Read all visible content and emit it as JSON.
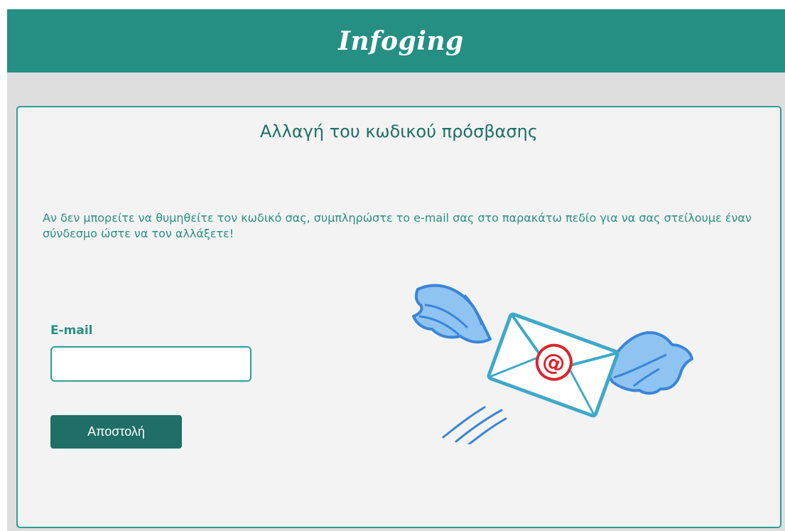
{
  "header": {
    "brand": "Infoging"
  },
  "card": {
    "title": "Αλλαγή του κωδικού πρόσβασης",
    "intro": "Αν δεν μπορείτε να θυμηθείτε τον κωδικό σας, συμπληρώστε το e-mail σας στο παρακάτω πεδίο για να σας στείλουμε έναν σύνδεσμο ώστε να τον αλλάξετε!",
    "email_label": "E-mail",
    "email_value": "",
    "email_placeholder": "",
    "submit_label": "Αποστολή"
  },
  "illustration": {
    "icon": "flying-envelope-icon",
    "symbol": "@"
  },
  "colors": {
    "header_bg": "#268f84",
    "accent": "#2a8f85",
    "button_bg": "#1f6f67",
    "page_bg": "#dedede",
    "card_bg": "#f3f3f3",
    "wing_blue": "#4d9fe6",
    "envelope_border": "#3ea9c9",
    "at_red": "#d9262b"
  }
}
